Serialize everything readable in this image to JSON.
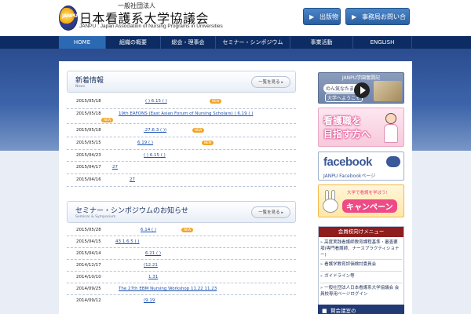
{
  "header": {
    "logo_badge": "JANPU",
    "org_type": "一般社団法人",
    "org_name": "日本看護系大学協議会",
    "org_name_en": "JANPU : Japan Association of Nursing Programs in Universities",
    "publications_button": "出版物",
    "contact_button": "事務局お問い合わせ"
  },
  "nav": {
    "items": [
      "HOME",
      "組織の概要",
      "総会・理事会",
      "セミナー・シンポジウム",
      "事業活動",
      "ENGLISH"
    ]
  },
  "news": {
    "title": "新着情報",
    "subtitle": "News",
    "more_label": "一覧を見る",
    "new_badge": "NEW",
    "rows": [
      {
        "date": "2015/05/18",
        "title": "( )          6.15 ( )"
      },
      {
        "date": "2015/05/18",
        "title": "19th EAFONS (East Asian Forum of Nursing Scholars)          (       6.19 ( )"
      },
      {
        "date": "2015/05/18",
        "title": ".27.6.3 ( ))"
      },
      {
        "date": "2015/05/15",
        "title": "6.19 ( )"
      },
      {
        "date": "2015/04/23",
        "title": "( )          6.15 ( )"
      },
      {
        "date": "2015/04/17",
        "title": "27"
      },
      {
        "date": "2015/04/16",
        "title": "27"
      }
    ]
  },
  "seminar": {
    "title": "セミナー・シンポジウムのお知らせ",
    "subtitle": "Seminar & Symposium",
    "more_label": "一覧を見る",
    "new_badge": "NEW",
    "rows": [
      {
        "date": "2015/05/28",
        "title": "6.14 ( )"
      },
      {
        "date": "2015/04/15",
        "title": "43                                        1                              6.5 ( )"
      },
      {
        "date": "2015/04/14",
        "title": "6.21 ( )"
      },
      {
        "date": "2014/12/17",
        "title": "(12.21"
      },
      {
        "date": "2014/10/10",
        "title": "1.31"
      },
      {
        "date": "2014/09/25",
        "title": "The 27th EBM Nursing Workshop                    11.22     11.23"
      },
      {
        "date": "2014/09/12",
        "title": "(9.19"
      }
    ]
  },
  "sidebar": {
    "banner1_title": "JANPU学園奮闘記",
    "banner1_tag": "のん気なたまごへ",
    "banner1_tag2": "大学へようこそ",
    "banner2_line1": "看護職を",
    "banner2_line2": "目指す方へ",
    "facebook_logo": "facebook",
    "facebook_sub": "JANPU Facebookページ",
    "banner4_top": "大学で看護を学ぼう!",
    "banner4_main": "キャンペーン",
    "menu_title": "会員校向けメニュー",
    "menu_items": [
      "高度実践看護師教育課程基準・審査要項(専門看護師、ナースプラクティショナー)",
      "看護学教育評価検討委員会",
      "ガイドライン等",
      "一般社団法人日本看護系大学協議会 会員校専用ページログイン"
    ],
    "bottom_banner": "賛会議室の"
  }
}
